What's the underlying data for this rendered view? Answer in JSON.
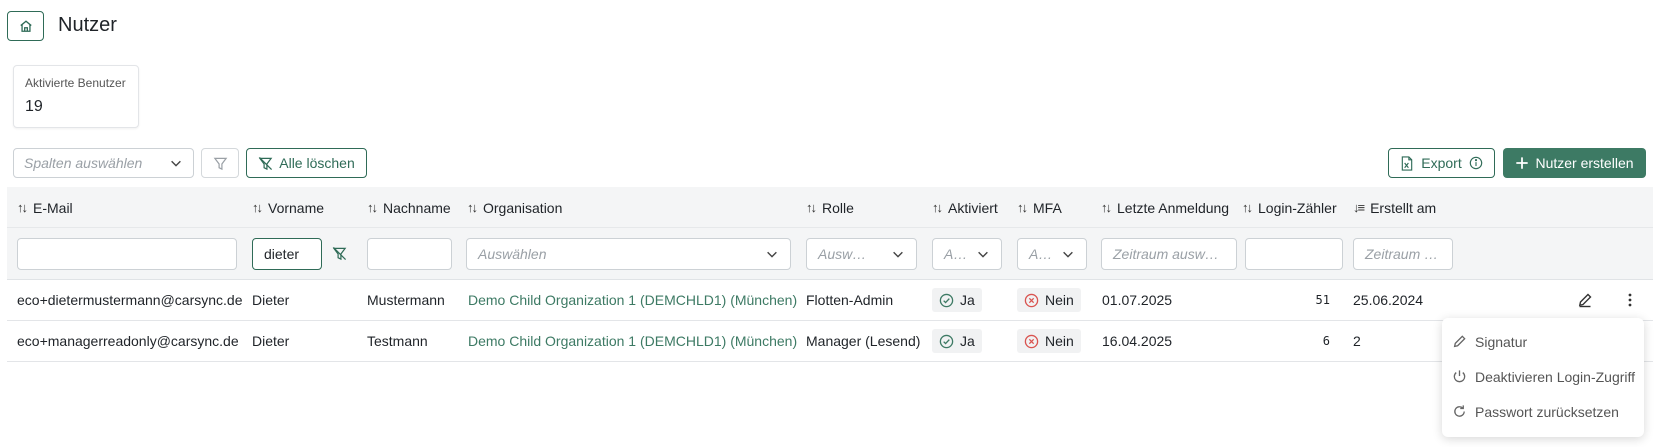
{
  "header": {
    "title": "Nutzer"
  },
  "stat": {
    "label": "Aktivierte Benutzer",
    "value": "19"
  },
  "toolbar": {
    "columns_placeholder": "Spalten auswählen",
    "clear_label": "Alle löschen",
    "export_label": "Export",
    "create_label": "Nutzer erstellen"
  },
  "table": {
    "headers": {
      "email": "E-Mail",
      "firstname": "Vorname",
      "lastname": "Nachname",
      "organisation": "Organisation",
      "role": "Rolle",
      "active": "Aktiviert",
      "mfa": "MFA",
      "last_login": "Letzte Anmeldung",
      "login_count": "Login-Zähler",
      "created": "Erstellt am"
    },
    "filters": {
      "email": "",
      "firstname": "dieter",
      "lastname": "",
      "organisation_placeholder": "Auswählen",
      "role_placeholder": "Ausw…",
      "active_placeholder": "A…",
      "mfa_placeholder": "A…",
      "last_login_placeholder": "Zeitraum ausw…",
      "login_count": "",
      "created_placeholder": "Zeitraum …"
    },
    "rows": [
      {
        "email": "eco+dietermustermann@carsync.de",
        "firstname": "Dieter",
        "lastname": "Mustermann",
        "organisation": "Demo Child Organization 1 (DEMCHLD1) (München)",
        "role": "Flotten-Admin",
        "active": "Ja",
        "mfa": "Nein",
        "last_login": "01.07.2025",
        "login_count": "51",
        "created": "25.06.2024"
      },
      {
        "email": "eco+managerreadonly@carsync.de",
        "firstname": "Dieter",
        "lastname": "Testmann",
        "organisation": "Demo Child Organization 1 (DEMCHLD1) (München)",
        "role": "Manager (Lesend)",
        "active": "Ja",
        "mfa": "Nein",
        "last_login": "16.04.2025",
        "login_count": "6",
        "created": "2"
      }
    ]
  },
  "context_menu": {
    "items": [
      {
        "label": "Signatur",
        "icon": "pencil-icon"
      },
      {
        "label": "Deaktivieren Login-Zugriff",
        "icon": "power-icon"
      },
      {
        "label": "Passwort zurücksetzen",
        "icon": "refresh-icon"
      }
    ]
  },
  "colors": {
    "accent": "#3d7a64",
    "accent_dark": "#2f6b57",
    "danger": "#d9534f"
  }
}
